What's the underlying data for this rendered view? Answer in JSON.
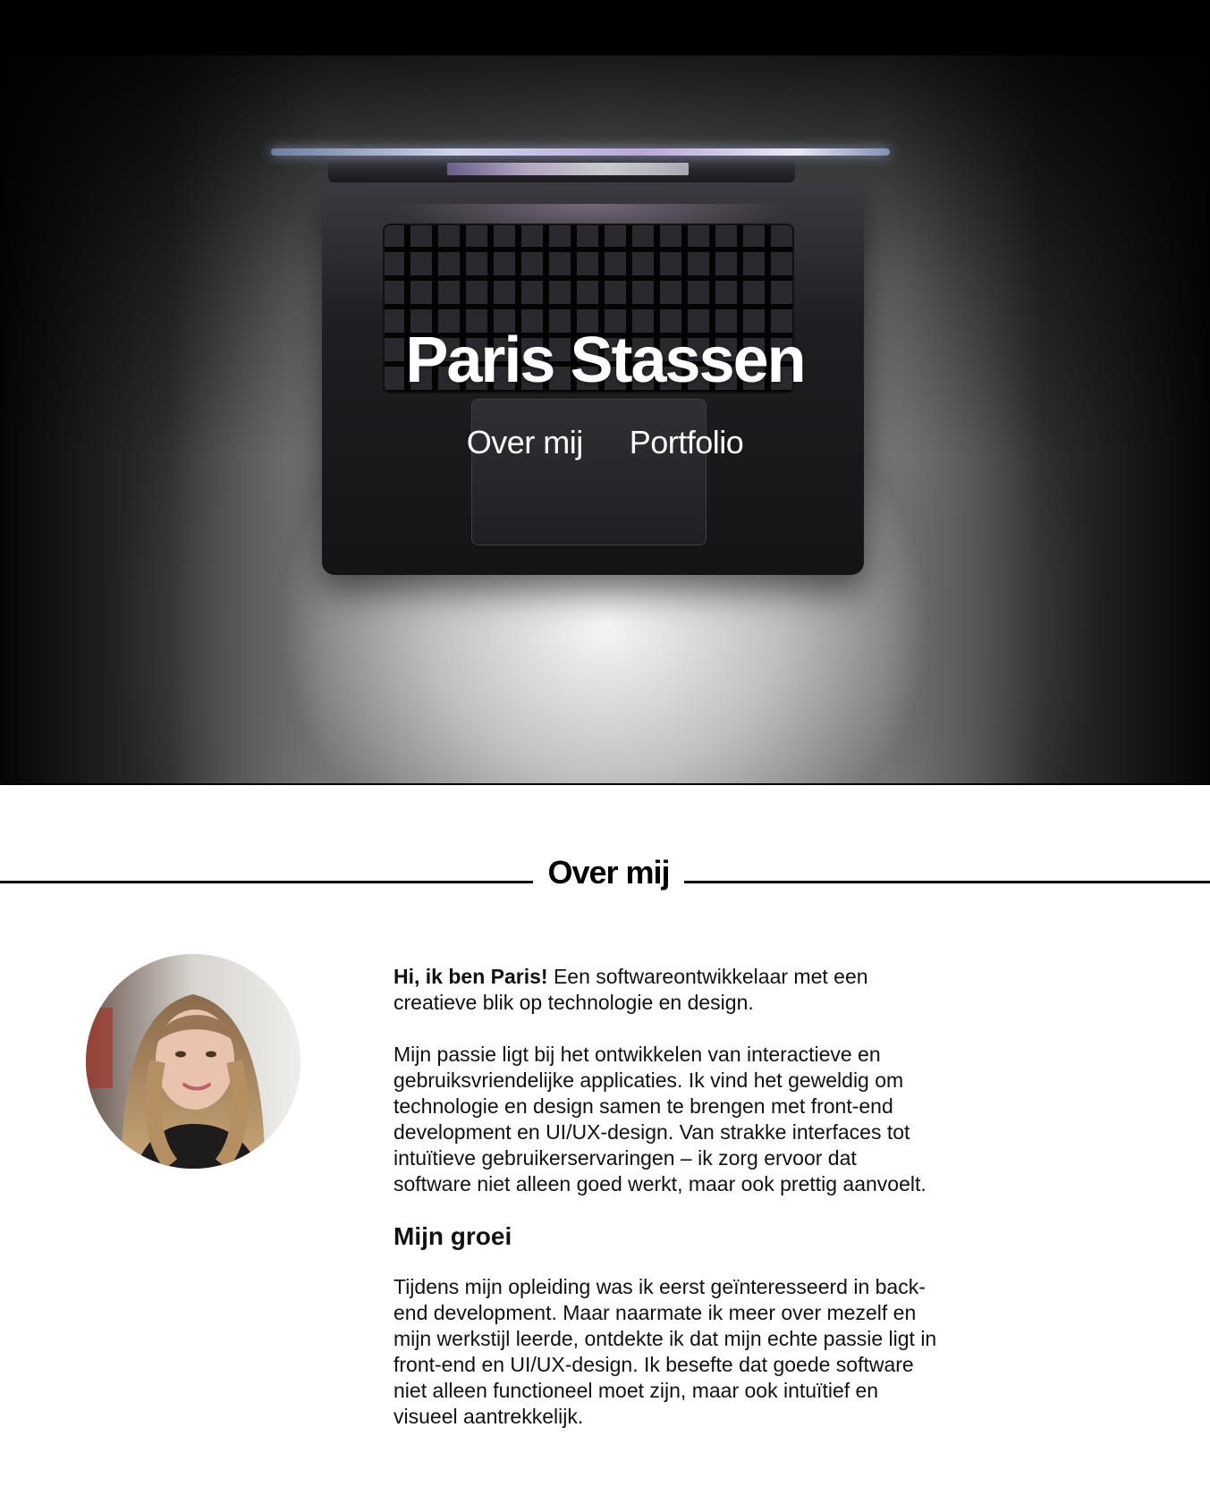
{
  "hero": {
    "title": "Paris Stassen",
    "nav": [
      {
        "label": "Over mij"
      },
      {
        "label": "Portfolio"
      }
    ]
  },
  "about": {
    "heading": "Over mij",
    "intro_bold": "Hi, ik ben Paris!",
    "intro_rest": " Een softwareontwikkelaar met een creatieve blik op technologie en design.",
    "paragraph_2": "Mijn passie ligt bij het ontwikkelen van interactieve en gebruiksvriendelijke applicaties. Ik vind het geweldig om technologie en design samen te brengen met front-end development en UI/UX-design. Van strakke interfaces tot intuïtieve gebruikerservaringen – ik zorg ervoor dat software niet alleen goed werkt, maar ook prettig aanvoelt.",
    "growth_heading": "Mijn groei",
    "growth_text": "Tijdens mijn opleiding was ik eerst geïnteresseerd in back-end development. Maar naarmate ik meer over mezelf en mijn werkstijl leerde, ontdekte ik dat mijn echte passie ligt in front-end en UI/UX-design. Ik besefte dat goede software niet alleen functioneel moet zijn, maar ook intuïtief en visueel aantrekkelijk."
  },
  "colors": {
    "background": "#ffffff",
    "hero_text": "#ffffff",
    "body_text": "#111111",
    "rule": "#000000"
  }
}
